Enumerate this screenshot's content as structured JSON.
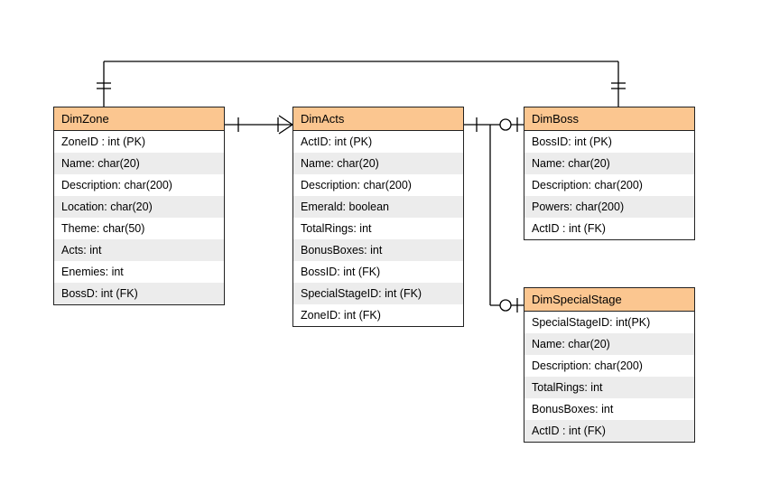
{
  "entities": {
    "dimZone": {
      "title": "DimZone",
      "rows": [
        "ZoneID : int (PK)",
        "Name: char(20)",
        "Description: char(200)",
        "Location: char(20)",
        "Theme: char(50)",
        "Acts: int",
        "Enemies: int",
        "BossD: int (FK)"
      ]
    },
    "dimActs": {
      "title": "DimActs",
      "rows": [
        "ActID: int (PK)",
        "Name: char(20)",
        "Description: char(200)",
        "Emerald: boolean",
        "TotalRings: int",
        "BonusBoxes: int",
        "BossID: int (FK)",
        "SpecialStageID: int (FK)",
        "ZoneID: int (FK)"
      ]
    },
    "dimBoss": {
      "title": "DimBoss",
      "rows": [
        "BossID: int (PK)",
        "Name: char(20)",
        "Description: char(200)",
        "Powers: char(200)",
        "ActID : int (FK)"
      ]
    },
    "dimSpecialStage": {
      "title": "DimSpecialStage",
      "rows": [
        "SpecialStageID: int(PK)",
        "Name: char(20)",
        "Description: char(200)",
        "TotalRings: int",
        "BonusBoxes: int",
        "ActID : int (FK)"
      ]
    }
  }
}
